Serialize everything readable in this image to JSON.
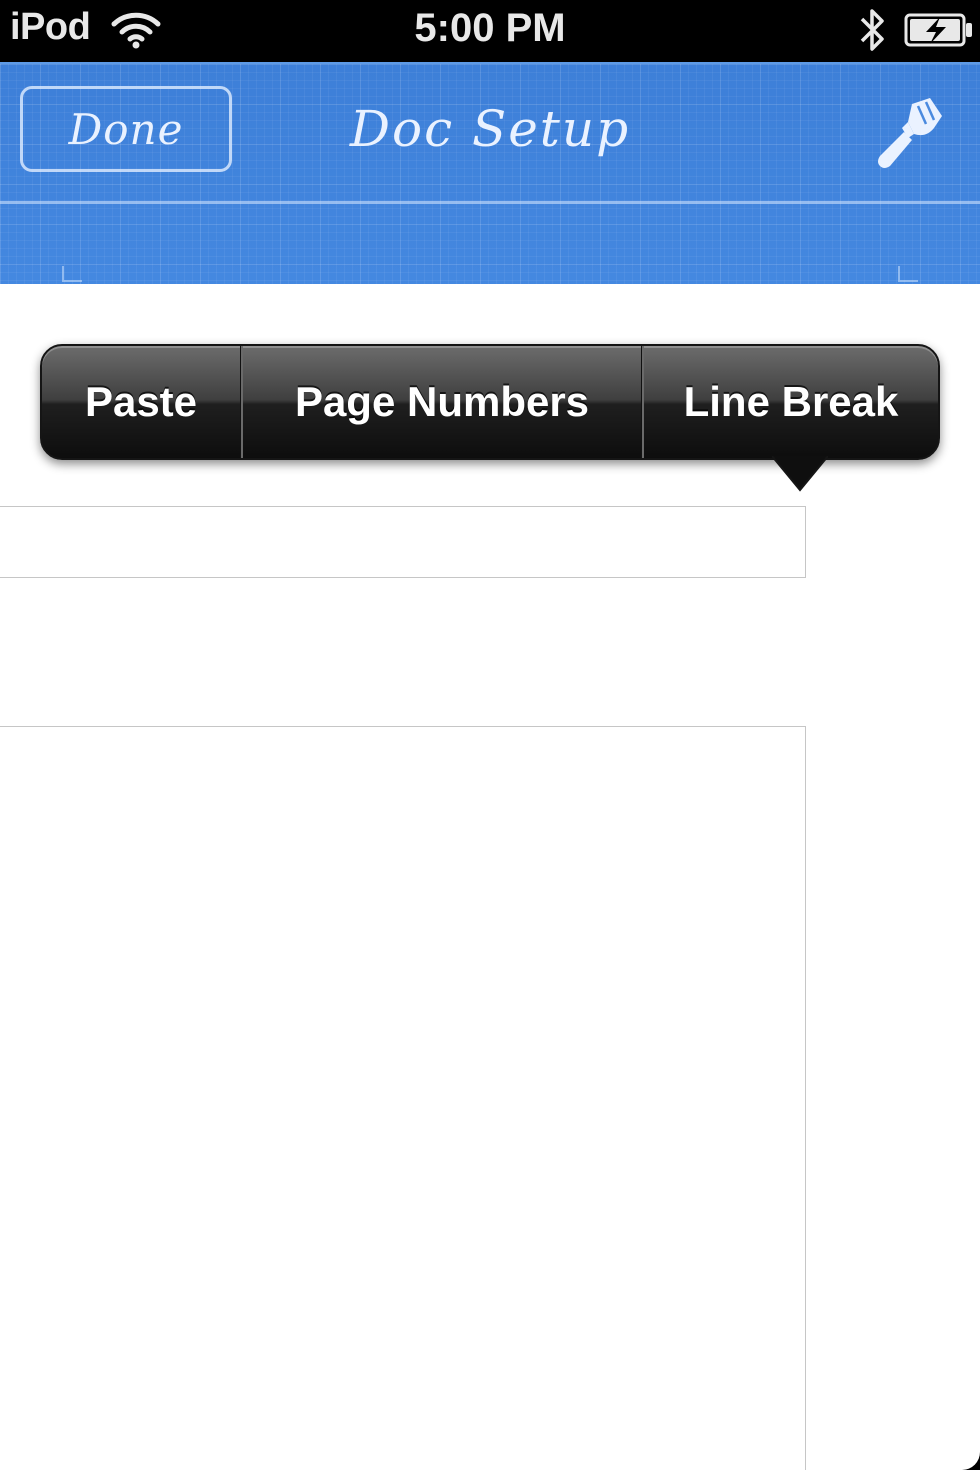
{
  "status_bar": {
    "carrier": "iPod",
    "time": "5:00 PM",
    "icons": [
      "wifi-icon",
      "bluetooth-icon",
      "battery-charging-icon"
    ]
  },
  "header": {
    "done_label": "Done",
    "title": "Doc Setup",
    "right_icon": "paint-brush-icon",
    "background_color": "#3f82dc"
  },
  "edit_menu": {
    "items": [
      {
        "label": "Paste"
      },
      {
        "label": "Page Numbers"
      },
      {
        "label": "Line Break"
      }
    ]
  },
  "content": {
    "text_field_value": "",
    "text_area_value": ""
  }
}
